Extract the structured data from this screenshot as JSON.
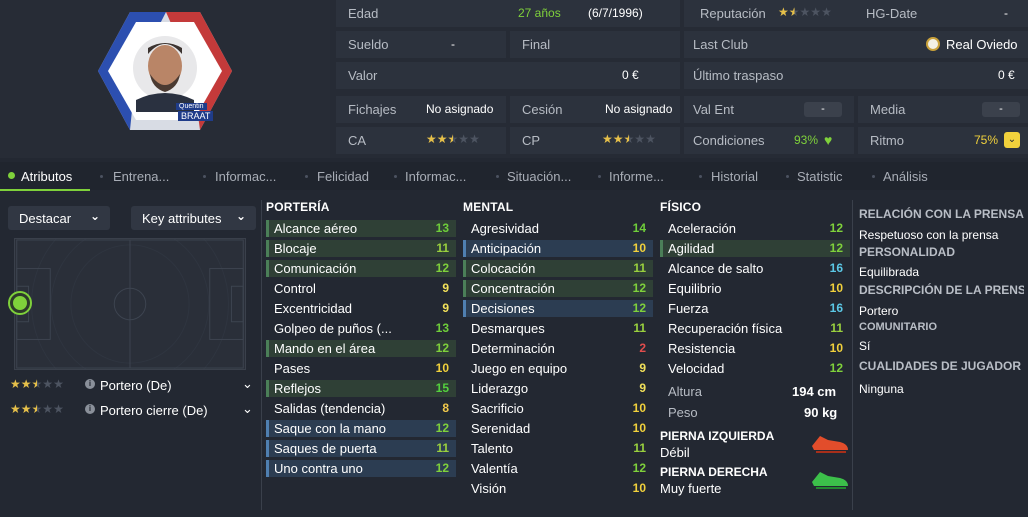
{
  "player": {
    "first_name": "Quentin",
    "last_name": "BRAAT"
  },
  "info": {
    "age_label": "Edad",
    "age_value": "27 años",
    "birth_date": "(6/7/1996)",
    "wage_label": "Sueldo",
    "wage_value": "-",
    "end_label": "Final",
    "value_label": "Valor",
    "value_value": "0 €",
    "signings_label": "Fichajes",
    "signings_value": "No asignado",
    "loan_label": "Cesión",
    "loan_value": "No asignado",
    "ca_label": "CA",
    "ca_stars": 2.5,
    "cp_label": "CP",
    "cp_stars": 2.5,
    "reputation_label": "Reputación",
    "reputation_stars": 1.5,
    "hg_label": "HG-Date",
    "hg_value": "-",
    "last_club_label": "Last Club",
    "last_club_value": "Real Oviedo",
    "last_transfer_label": "Último traspaso",
    "last_transfer_value": "0 €",
    "valent_label": "Val Ent",
    "valent_value": "-",
    "media_label": "Media",
    "media_value": "-",
    "condition_label": "Condiciones",
    "condition_value": "93%",
    "rhythm_label": "Ritmo",
    "rhythm_value": "75%"
  },
  "tabs": [
    "Atributos",
    "Entrena...",
    "Informac...",
    "Felicidad",
    "Informac...",
    "Situación...",
    "Informe...",
    "Historial",
    "Statistic",
    "Análisis"
  ],
  "left": {
    "highlight_label": "Destacar",
    "key_label": "Key attributes",
    "roles": [
      {
        "stars": 2.5,
        "label": "Portero (De)"
      },
      {
        "stars": 2.5,
        "label": "Portero cierre (De)"
      }
    ]
  },
  "goalkeeping": {
    "title": "PORTERÍA",
    "rows": [
      {
        "name": "Alcance aéreo",
        "value": 13,
        "hl": "g"
      },
      {
        "name": "Blocaje",
        "value": 11,
        "hl": "g"
      },
      {
        "name": "Comunicación",
        "value": 12,
        "hl": "g"
      },
      {
        "name": "Control",
        "value": 9,
        "hl": ""
      },
      {
        "name": "Excentricidad",
        "value": 9,
        "hl": ""
      },
      {
        "name": "Golpeo de puños (...",
        "value": 13,
        "hl": ""
      },
      {
        "name": "Mando en el área",
        "value": 12,
        "hl": "g"
      },
      {
        "name": "Pases",
        "value": 10,
        "hl": ""
      },
      {
        "name": "Reflejos",
        "value": 15,
        "hl": "g"
      },
      {
        "name": "Salidas (tendencia)",
        "value": 8,
        "hl": ""
      },
      {
        "name": "Saque con la mano",
        "value": 12,
        "hl": "b"
      },
      {
        "name": "Saques de puerta",
        "value": 11,
        "hl": "b"
      },
      {
        "name": "Uno contra uno",
        "value": 12,
        "hl": "b"
      }
    ]
  },
  "mental": {
    "title": "MENTAL",
    "rows": [
      {
        "name": "Agresividad",
        "value": 14,
        "hl": ""
      },
      {
        "name": "Anticipación",
        "value": 10,
        "hl": "b"
      },
      {
        "name": "Colocación",
        "value": 11,
        "hl": "g"
      },
      {
        "name": "Concentración",
        "value": 12,
        "hl": "g"
      },
      {
        "name": "Decisiones",
        "value": 12,
        "hl": "b"
      },
      {
        "name": "Desmarques",
        "value": 11,
        "hl": ""
      },
      {
        "name": "Determinación",
        "value": 2,
        "hl": ""
      },
      {
        "name": "Juego en equipo",
        "value": 9,
        "hl": ""
      },
      {
        "name": "Liderazgo",
        "value": 9,
        "hl": ""
      },
      {
        "name": "Sacrificio",
        "value": 10,
        "hl": ""
      },
      {
        "name": "Serenidad",
        "value": 10,
        "hl": ""
      },
      {
        "name": "Talento",
        "value": 11,
        "hl": ""
      },
      {
        "name": "Valentía",
        "value": 12,
        "hl": ""
      },
      {
        "name": "Visión",
        "value": 10,
        "hl": ""
      }
    ]
  },
  "physical": {
    "title": "FÍSICO",
    "rows": [
      {
        "name": "Aceleración",
        "value": 12,
        "hl": ""
      },
      {
        "name": "Agilidad",
        "value": 12,
        "hl": "g"
      },
      {
        "name": "Alcance de salto",
        "value": 16,
        "hl": ""
      },
      {
        "name": "Equilibrio",
        "value": 10,
        "hl": ""
      },
      {
        "name": "Fuerza",
        "value": 16,
        "hl": ""
      },
      {
        "name": "Recuperación física",
        "value": 11,
        "hl": ""
      },
      {
        "name": "Resistencia",
        "value": 10,
        "hl": ""
      },
      {
        "name": "Velocidad",
        "value": 12,
        "hl": ""
      }
    ],
    "height_label": "Altura",
    "height_value": "194 cm",
    "weight_label": "Peso",
    "weight_value": "90 kg",
    "left_foot_label": "PIERNA IZQUIERDA",
    "left_foot_value": "Débil",
    "right_foot_label": "PIERNA DERECHA",
    "right_foot_value": "Muy fuerte"
  },
  "side": {
    "rel_label": "RELACIÓN CON LA PRENSA",
    "rel_value": "Respetuoso con la prensa",
    "pers_label": "PERSONALIDAD",
    "pers_value": "Equilibrada",
    "desc_label": "DESCRIPCIÓN DE LA PRENSA",
    "desc_value": "Portero",
    "comm_label": "COMUNITARIO",
    "comm_value": "Sí",
    "qual_label": "CUALIDADES DE JUGADOR",
    "qual_value": "Ninguna"
  },
  "colors": {
    "accent": "#7fd13b",
    "blue_hl": "#2c3d52",
    "green_hl": "#2f4036"
  }
}
